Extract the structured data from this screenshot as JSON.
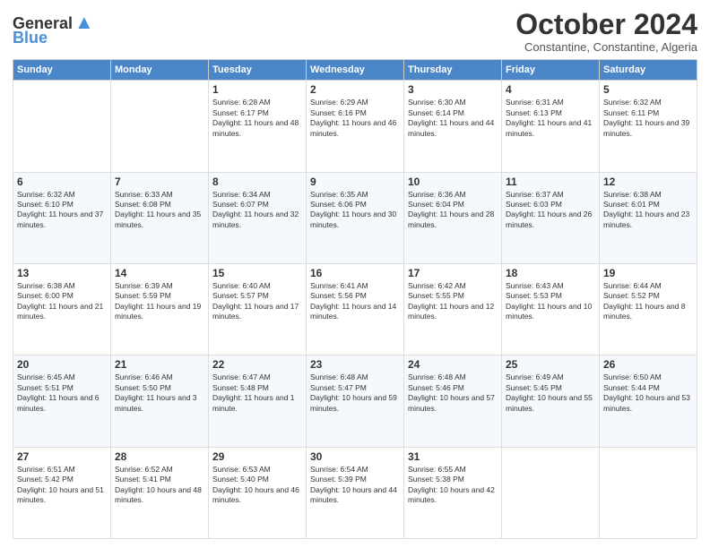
{
  "logo": {
    "line1": "General",
    "line2": "Blue"
  },
  "header": {
    "month": "October 2024",
    "location": "Constantine, Constantine, Algeria"
  },
  "weekdays": [
    "Sunday",
    "Monday",
    "Tuesday",
    "Wednesday",
    "Thursday",
    "Friday",
    "Saturday"
  ],
  "weeks": [
    [
      {
        "day": "",
        "sunrise": "",
        "sunset": "",
        "daylight": ""
      },
      {
        "day": "",
        "sunrise": "",
        "sunset": "",
        "daylight": ""
      },
      {
        "day": "1",
        "sunrise": "Sunrise: 6:28 AM",
        "sunset": "Sunset: 6:17 PM",
        "daylight": "Daylight: 11 hours and 48 minutes."
      },
      {
        "day": "2",
        "sunrise": "Sunrise: 6:29 AM",
        "sunset": "Sunset: 6:16 PM",
        "daylight": "Daylight: 11 hours and 46 minutes."
      },
      {
        "day": "3",
        "sunrise": "Sunrise: 6:30 AM",
        "sunset": "Sunset: 6:14 PM",
        "daylight": "Daylight: 11 hours and 44 minutes."
      },
      {
        "day": "4",
        "sunrise": "Sunrise: 6:31 AM",
        "sunset": "Sunset: 6:13 PM",
        "daylight": "Daylight: 11 hours and 41 minutes."
      },
      {
        "day": "5",
        "sunrise": "Sunrise: 6:32 AM",
        "sunset": "Sunset: 6:11 PM",
        "daylight": "Daylight: 11 hours and 39 minutes."
      }
    ],
    [
      {
        "day": "6",
        "sunrise": "Sunrise: 6:32 AM",
        "sunset": "Sunset: 6:10 PM",
        "daylight": "Daylight: 11 hours and 37 minutes."
      },
      {
        "day": "7",
        "sunrise": "Sunrise: 6:33 AM",
        "sunset": "Sunset: 6:08 PM",
        "daylight": "Daylight: 11 hours and 35 minutes."
      },
      {
        "day": "8",
        "sunrise": "Sunrise: 6:34 AM",
        "sunset": "Sunset: 6:07 PM",
        "daylight": "Daylight: 11 hours and 32 minutes."
      },
      {
        "day": "9",
        "sunrise": "Sunrise: 6:35 AM",
        "sunset": "Sunset: 6:06 PM",
        "daylight": "Daylight: 11 hours and 30 minutes."
      },
      {
        "day": "10",
        "sunrise": "Sunrise: 6:36 AM",
        "sunset": "Sunset: 6:04 PM",
        "daylight": "Daylight: 11 hours and 28 minutes."
      },
      {
        "day": "11",
        "sunrise": "Sunrise: 6:37 AM",
        "sunset": "Sunset: 6:03 PM",
        "daylight": "Daylight: 11 hours and 26 minutes."
      },
      {
        "day": "12",
        "sunrise": "Sunrise: 6:38 AM",
        "sunset": "Sunset: 6:01 PM",
        "daylight": "Daylight: 11 hours and 23 minutes."
      }
    ],
    [
      {
        "day": "13",
        "sunrise": "Sunrise: 6:38 AM",
        "sunset": "Sunset: 6:00 PM",
        "daylight": "Daylight: 11 hours and 21 minutes."
      },
      {
        "day": "14",
        "sunrise": "Sunrise: 6:39 AM",
        "sunset": "Sunset: 5:59 PM",
        "daylight": "Daylight: 11 hours and 19 minutes."
      },
      {
        "day": "15",
        "sunrise": "Sunrise: 6:40 AM",
        "sunset": "Sunset: 5:57 PM",
        "daylight": "Daylight: 11 hours and 17 minutes."
      },
      {
        "day": "16",
        "sunrise": "Sunrise: 6:41 AM",
        "sunset": "Sunset: 5:56 PM",
        "daylight": "Daylight: 11 hours and 14 minutes."
      },
      {
        "day": "17",
        "sunrise": "Sunrise: 6:42 AM",
        "sunset": "Sunset: 5:55 PM",
        "daylight": "Daylight: 11 hours and 12 minutes."
      },
      {
        "day": "18",
        "sunrise": "Sunrise: 6:43 AM",
        "sunset": "Sunset: 5:53 PM",
        "daylight": "Daylight: 11 hours and 10 minutes."
      },
      {
        "day": "19",
        "sunrise": "Sunrise: 6:44 AM",
        "sunset": "Sunset: 5:52 PM",
        "daylight": "Daylight: 11 hours and 8 minutes."
      }
    ],
    [
      {
        "day": "20",
        "sunrise": "Sunrise: 6:45 AM",
        "sunset": "Sunset: 5:51 PM",
        "daylight": "Daylight: 11 hours and 6 minutes."
      },
      {
        "day": "21",
        "sunrise": "Sunrise: 6:46 AM",
        "sunset": "Sunset: 5:50 PM",
        "daylight": "Daylight: 11 hours and 3 minutes."
      },
      {
        "day": "22",
        "sunrise": "Sunrise: 6:47 AM",
        "sunset": "Sunset: 5:48 PM",
        "daylight": "Daylight: 11 hours and 1 minute."
      },
      {
        "day": "23",
        "sunrise": "Sunrise: 6:48 AM",
        "sunset": "Sunset: 5:47 PM",
        "daylight": "Daylight: 10 hours and 59 minutes."
      },
      {
        "day": "24",
        "sunrise": "Sunrise: 6:48 AM",
        "sunset": "Sunset: 5:46 PM",
        "daylight": "Daylight: 10 hours and 57 minutes."
      },
      {
        "day": "25",
        "sunrise": "Sunrise: 6:49 AM",
        "sunset": "Sunset: 5:45 PM",
        "daylight": "Daylight: 10 hours and 55 minutes."
      },
      {
        "day": "26",
        "sunrise": "Sunrise: 6:50 AM",
        "sunset": "Sunset: 5:44 PM",
        "daylight": "Daylight: 10 hours and 53 minutes."
      }
    ],
    [
      {
        "day": "27",
        "sunrise": "Sunrise: 6:51 AM",
        "sunset": "Sunset: 5:42 PM",
        "daylight": "Daylight: 10 hours and 51 minutes."
      },
      {
        "day": "28",
        "sunrise": "Sunrise: 6:52 AM",
        "sunset": "Sunset: 5:41 PM",
        "daylight": "Daylight: 10 hours and 48 minutes."
      },
      {
        "day": "29",
        "sunrise": "Sunrise: 6:53 AM",
        "sunset": "Sunset: 5:40 PM",
        "daylight": "Daylight: 10 hours and 46 minutes."
      },
      {
        "day": "30",
        "sunrise": "Sunrise: 6:54 AM",
        "sunset": "Sunset: 5:39 PM",
        "daylight": "Daylight: 10 hours and 44 minutes."
      },
      {
        "day": "31",
        "sunrise": "Sunrise: 6:55 AM",
        "sunset": "Sunset: 5:38 PM",
        "daylight": "Daylight: 10 hours and 42 minutes."
      },
      {
        "day": "",
        "sunrise": "",
        "sunset": "",
        "daylight": ""
      },
      {
        "day": "",
        "sunrise": "",
        "sunset": "",
        "daylight": ""
      }
    ]
  ]
}
